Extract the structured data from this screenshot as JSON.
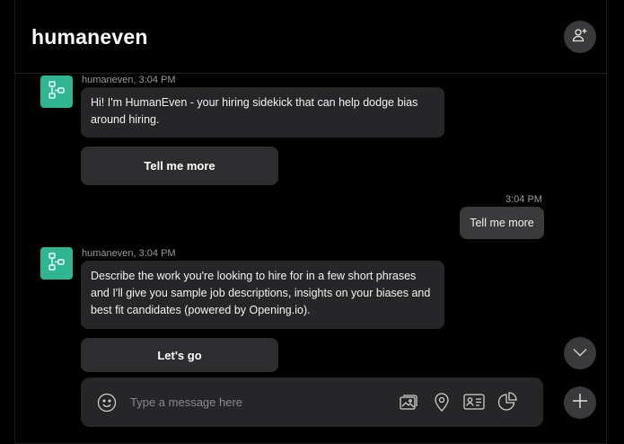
{
  "header": {
    "title": "humaneven"
  },
  "messages": [
    {
      "meta": "humaneven, 3:04 PM",
      "text": "Hi! I'm HumanEven - your hiring sidekick that can help dodge bias around hiring.",
      "action": "Tell me more"
    },
    {
      "time": "3:04 PM",
      "text": "Tell me more"
    },
    {
      "meta": "humaneven, 3:04 PM",
      "text": "Describe the work you're looking to hire for in a few short phrases and I'll give you sample job descriptions, insights on your biases and best fit candidates (powered by Opening.io).",
      "action": "Let's go"
    }
  ],
  "composer": {
    "placeholder": "Type a message here"
  },
  "icons": {
    "add_user": "add-user-icon",
    "bot_avatar": "flow-icon",
    "scroll_down": "chevron-down-icon",
    "emoji": "smiley-icon",
    "image": "image-icon",
    "location": "location-pin-icon",
    "contact": "contact-card-icon",
    "chart": "pie-chart-icon",
    "plus": "plus-icon"
  },
  "colors": {
    "background": "#000000",
    "bubble": "#262628",
    "accent": "#2fb58f",
    "button": "#3a3a3c"
  }
}
